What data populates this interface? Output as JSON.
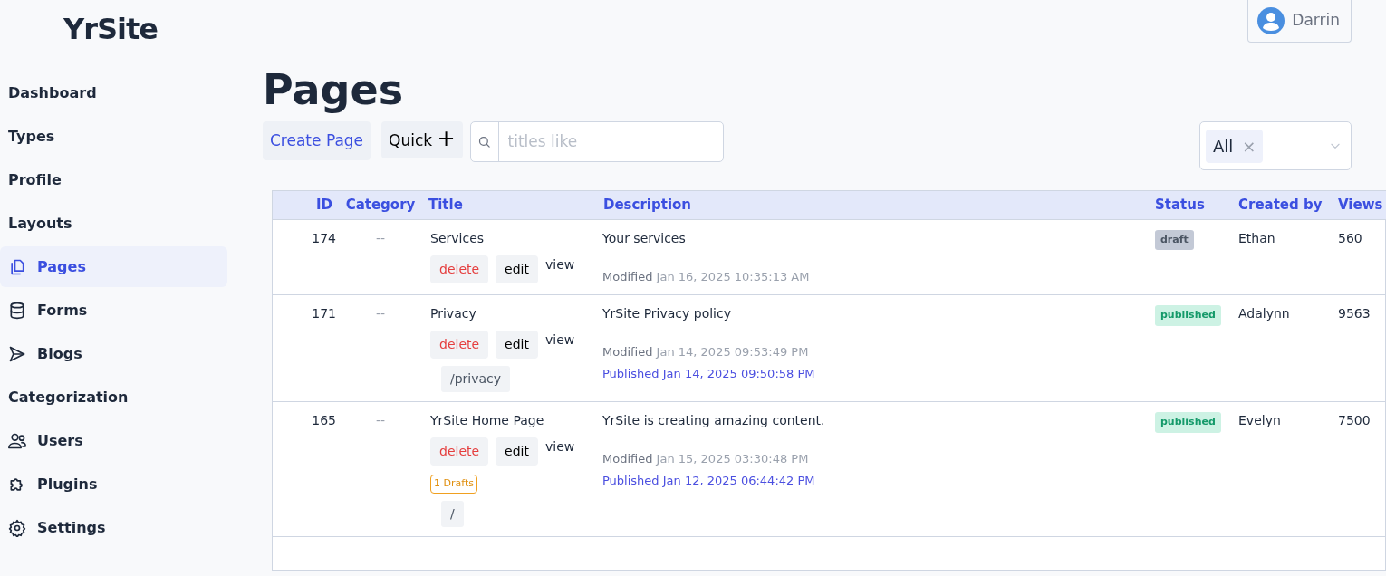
{
  "brand": "YrSite",
  "user": {
    "name": "Darrin"
  },
  "sidebar": {
    "items": [
      {
        "label": "Dashboard",
        "kind": "text",
        "selected": false
      },
      {
        "label": "Types",
        "kind": "text",
        "selected": false
      },
      {
        "label": "Profile",
        "kind": "text",
        "selected": false
      },
      {
        "label": "Layouts",
        "kind": "text",
        "selected": false
      },
      {
        "label": "Pages",
        "kind": "icon",
        "selected": true
      },
      {
        "label": "Forms",
        "kind": "icon",
        "selected": false
      },
      {
        "label": "Blogs",
        "kind": "icon",
        "selected": false
      },
      {
        "label": "Categorization",
        "kind": "text",
        "selected": false
      },
      {
        "label": "Users",
        "kind": "icon",
        "selected": false
      },
      {
        "label": "Plugins",
        "kind": "icon",
        "selected": false
      },
      {
        "label": "Settings",
        "kind": "icon",
        "selected": false
      }
    ]
  },
  "page_title": "Pages",
  "toolbar": {
    "create_button": "Create Page",
    "quick_button": "Quick",
    "quick_plus": "+",
    "search": {
      "placeholder": "titles like"
    },
    "filter": {
      "value": "All",
      "clear": "×"
    }
  },
  "table": {
    "columns": [
      "ID",
      "Category",
      "Title",
      "Description",
      "Status",
      "Created by",
      "Views"
    ],
    "rows": [
      {
        "id": "174",
        "category": "--",
        "title": "Services",
        "delete": "delete",
        "edit": "edit",
        "view": "view",
        "drafts": null,
        "slug": null,
        "description": "Your services",
        "modified_label": "Modified",
        "modified": "Jan 16, 2025 10:35:13 AM",
        "published_label": null,
        "published": null,
        "status": {
          "label": "draft",
          "kind": "draft"
        },
        "created_by": "Ethan",
        "views": "560"
      },
      {
        "id": "171",
        "category": "--",
        "title": "Privacy",
        "delete": "delete",
        "edit": "edit",
        "view": "view",
        "drafts": null,
        "slug": "/privacy",
        "description": "YrSite Privacy policy",
        "modified_label": "Modified",
        "modified": "Jan 14, 2025 09:53:49 PM",
        "published_label": "Published",
        "published": "Jan 14, 2025 09:50:58 PM",
        "status": {
          "label": "published",
          "kind": "published"
        },
        "created_by": "Adalynn",
        "views": "9563"
      },
      {
        "id": "165",
        "category": "--",
        "title": "YrSite Home Page",
        "delete": "delete",
        "edit": "edit",
        "view": "view",
        "drafts": "1 Drafts",
        "slug": "/",
        "description": "YrSite is creating amazing content.",
        "modified_label": "Modified",
        "modified": "Jan 15, 2025 03:30:48 PM",
        "published_label": "Published",
        "published": "Jan 12, 2025 06:44:42 PM",
        "status": {
          "label": "published",
          "kind": "published"
        },
        "created_by": "Evelyn",
        "views": "7500"
      }
    ]
  }
}
